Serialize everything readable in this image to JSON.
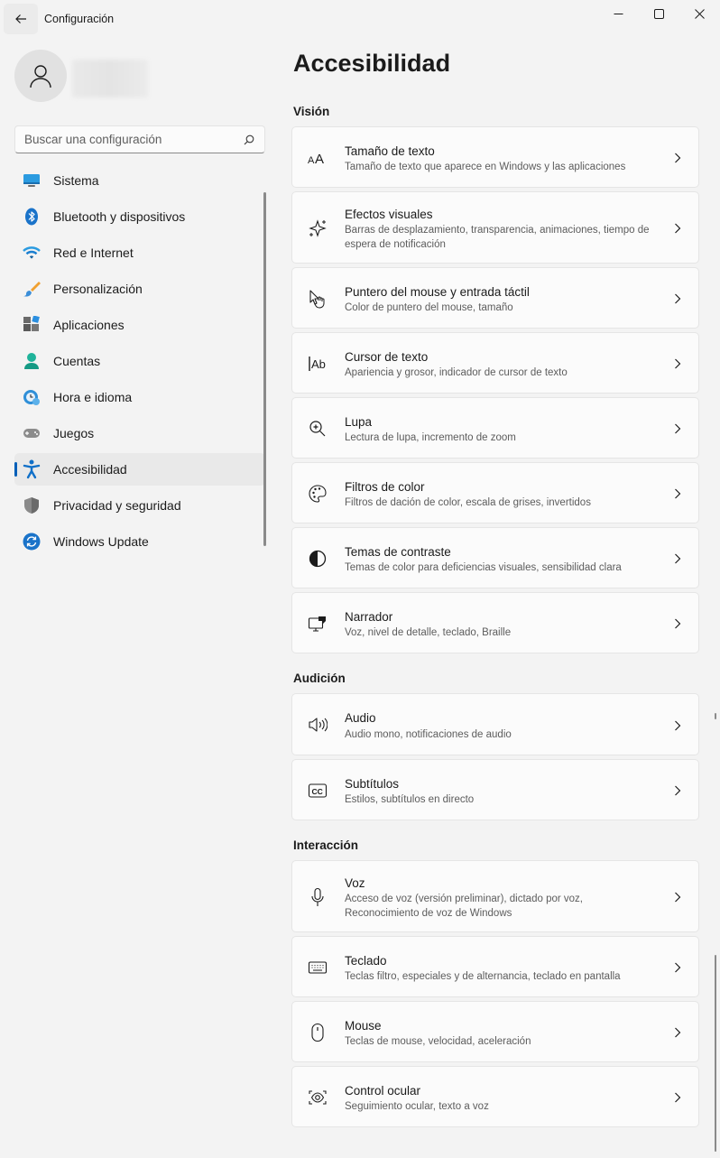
{
  "app": {
    "title": "Configuración"
  },
  "search": {
    "placeholder": "Buscar una configuración"
  },
  "sidebar": {
    "items": [
      {
        "label": "Sistema",
        "icon": "system-icon"
      },
      {
        "label": "Bluetooth y dispositivos",
        "icon": "bluetooth-icon"
      },
      {
        "label": "Red e Internet",
        "icon": "wifi-icon"
      },
      {
        "label": "Personalización",
        "icon": "brush-icon"
      },
      {
        "label": "Aplicaciones",
        "icon": "apps-icon"
      },
      {
        "label": "Cuentas",
        "icon": "account-icon"
      },
      {
        "label": "Hora e idioma",
        "icon": "clock-globe-icon"
      },
      {
        "label": "Juegos",
        "icon": "gamepad-icon"
      },
      {
        "label": "Accesibilidad",
        "icon": "accessibility-icon",
        "selected": true
      },
      {
        "label": "Privacidad y seguridad",
        "icon": "shield-icon"
      },
      {
        "label": "Windows Update",
        "icon": "update-icon"
      }
    ]
  },
  "main": {
    "title": "Accesibilidad",
    "sections": [
      {
        "title": "Visión",
        "cards": [
          {
            "title": "Tamaño de texto",
            "desc": "Tamaño de texto que aparece en Windows y las aplicaciones",
            "icon": "text-size-icon"
          },
          {
            "title": "Efectos visuales",
            "desc": "Barras de desplazamiento, transparencia, animaciones, tiempo de espera de notificación",
            "icon": "sparkle-icon"
          },
          {
            "title": "Puntero del mouse y entrada táctil",
            "desc": "Color de puntero del mouse, tamaño",
            "icon": "pointer-icon"
          },
          {
            "title": "Cursor de texto",
            "desc": "Apariencia y grosor, indicador de cursor de texto",
            "icon": "text-cursor-icon"
          },
          {
            "title": "Lupa",
            "desc": "Lectura de lupa, incremento de zoom",
            "icon": "magnifier-icon"
          },
          {
            "title": "Filtros de color",
            "desc": "Filtros de dación de color, escala de grises, invertidos",
            "icon": "palette-icon"
          },
          {
            "title": "Temas de contraste",
            "desc": "Temas de color para deficiencias visuales, sensibilidad clara",
            "icon": "contrast-icon"
          },
          {
            "title": "Narrador",
            "desc": "Voz, nivel de detalle, teclado, Braille",
            "icon": "narrator-icon"
          }
        ]
      },
      {
        "title": "Audición",
        "cards": [
          {
            "title": "Audio",
            "desc": "Audio mono, notificaciones de audio",
            "icon": "speaker-icon"
          },
          {
            "title": "Subtítulos",
            "desc": "Estilos, subtítulos en directo",
            "icon": "captions-icon"
          }
        ]
      },
      {
        "title": "Interacción",
        "cards": [
          {
            "title": "Voz",
            "desc": "Acceso de voz (versión preliminar), dictado por voz, Reconocimiento de voz de Windows",
            "icon": "microphone-icon"
          },
          {
            "title": "Teclado",
            "desc": "Teclas filtro, especiales y de alternancia, teclado en pantalla",
            "icon": "keyboard-icon"
          },
          {
            "title": "Mouse",
            "desc": "Teclas de mouse, velocidad, aceleración",
            "icon": "mouse-icon"
          },
          {
            "title": "Control ocular",
            "desc": "Seguimiento ocular, texto a voz",
            "icon": "eye-control-icon"
          }
        ]
      }
    ]
  },
  "colors": {
    "accent": "#005fb8",
    "background": "#f3f3f3",
    "card": "#fbfbfb"
  }
}
